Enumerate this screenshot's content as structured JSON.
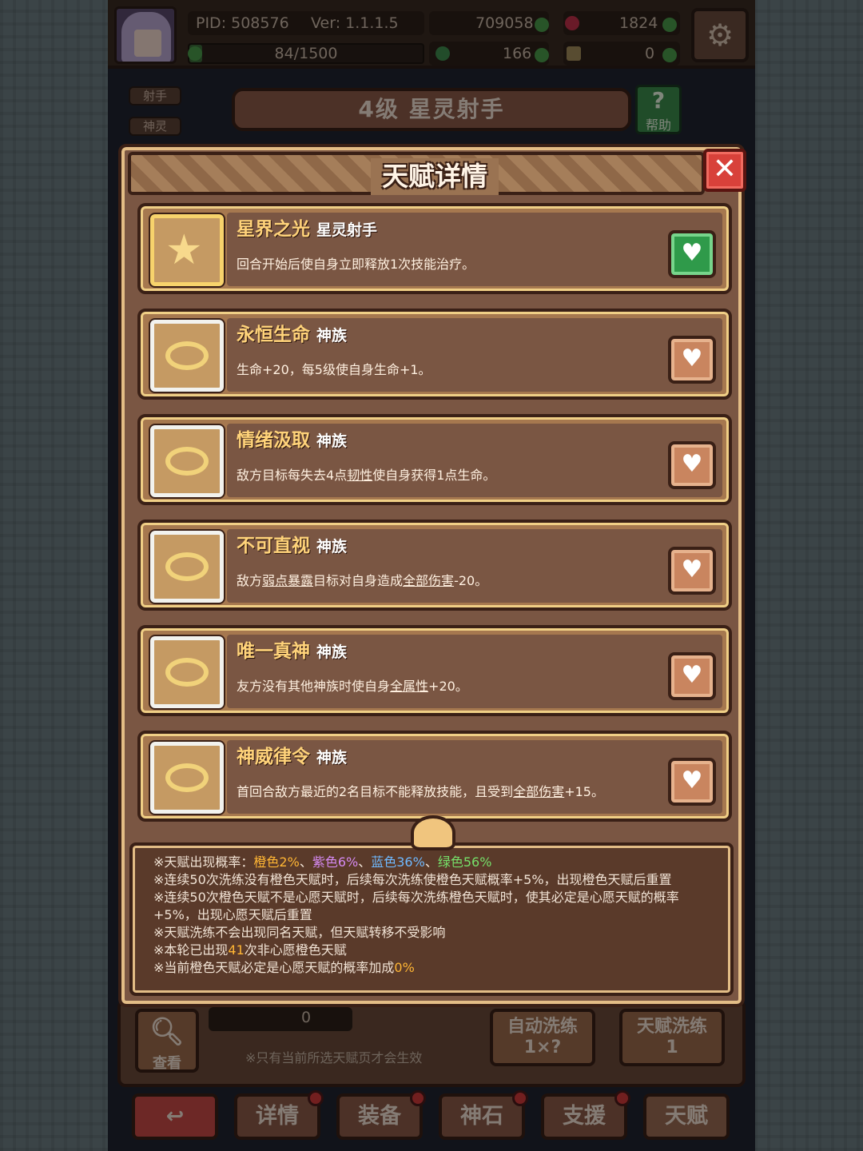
{
  "topbar": {
    "pid": "PID: 508576",
    "version": "Ver: 1.1.1.5",
    "gold": "709058",
    "gems": "1824",
    "xp": "84/1500",
    "xp_progress": 0.056,
    "clover": "166",
    "keys": "0"
  },
  "hero": {
    "tag1": "射手",
    "tag2": "神灵",
    "title": "4级 星灵射手",
    "help": "帮助"
  },
  "dialog": {
    "title": "天赋详情",
    "close": "✕",
    "talents": [
      {
        "name": "星界之光",
        "race": "星灵射手",
        "desc": "回合开始后使自身立即释放1次技能治疗。",
        "wish": true
      },
      {
        "name": "永恒生命",
        "race": "神族",
        "desc": "生命+20，每5级使自身生命+1。",
        "wish": false
      },
      {
        "name": "情绪汲取",
        "race": "神族",
        "desc_pre": "敌方目标每失去4点",
        "desc_u": "韧性",
        "desc_post": "使自身获得1点生命。",
        "wish": false
      },
      {
        "name": "不可直视",
        "race": "神族",
        "desc_pre": "敌方",
        "desc_u": "弱点暴露",
        "desc_mid": "目标对自身造成",
        "desc_u2": "全部伤害",
        "desc_post": "-20。",
        "wish": false
      },
      {
        "name": "唯一真神",
        "race": "神族",
        "desc_pre": "友方没有其他神族时使自身",
        "desc_u": "全属性",
        "desc_post": "+20。",
        "wish": false
      },
      {
        "name": "神威律令",
        "race": "神族",
        "desc_pre": "首回合敌方最近的2名目标不能释放技能，且受到",
        "desc_u": "全部伤害",
        "desc_post": "+15。",
        "wish": false
      }
    ],
    "info": {
      "prob_label": "※天赋出现概率：",
      "orange": "橙色2%",
      "purple": "紫色6%",
      "blue": "蓝色36%",
      "green": "绿色56%",
      "sep": "、",
      "line2": "※连续50次洗练没有橙色天赋时，后续每次洗练使橙色天赋概率+5%，出现橙色天赋后重置",
      "line3": "※连续50次橙色天赋不是心愿天赋时，后续每次洗练橙色天赋时，使其必定是心愿天赋的概率+5%，出现心愿天赋后重置",
      "line4": "※天赋洗练不会出现同名天赋，但天赋转移不受影响",
      "line5_pre": "※本轮已出现",
      "line5_num": "41",
      "line5_post": "次非心愿橙色天赋",
      "line6_pre": "※当前橙色天赋必定是心愿天赋的概率加成",
      "line6_num": "0%"
    }
  },
  "bottom": {
    "view": "查看",
    "count": "0",
    "note": "※只有当前所选天赋页才会生效",
    "auto_label": "自动洗练",
    "auto_cost": "1×?",
    "talent_label": "天赋洗练",
    "talent_cost": "1"
  },
  "nav": {
    "back": "↩",
    "details": "详情",
    "equip": "装备",
    "stone": "神石",
    "support": "支援",
    "talent": "天赋"
  }
}
